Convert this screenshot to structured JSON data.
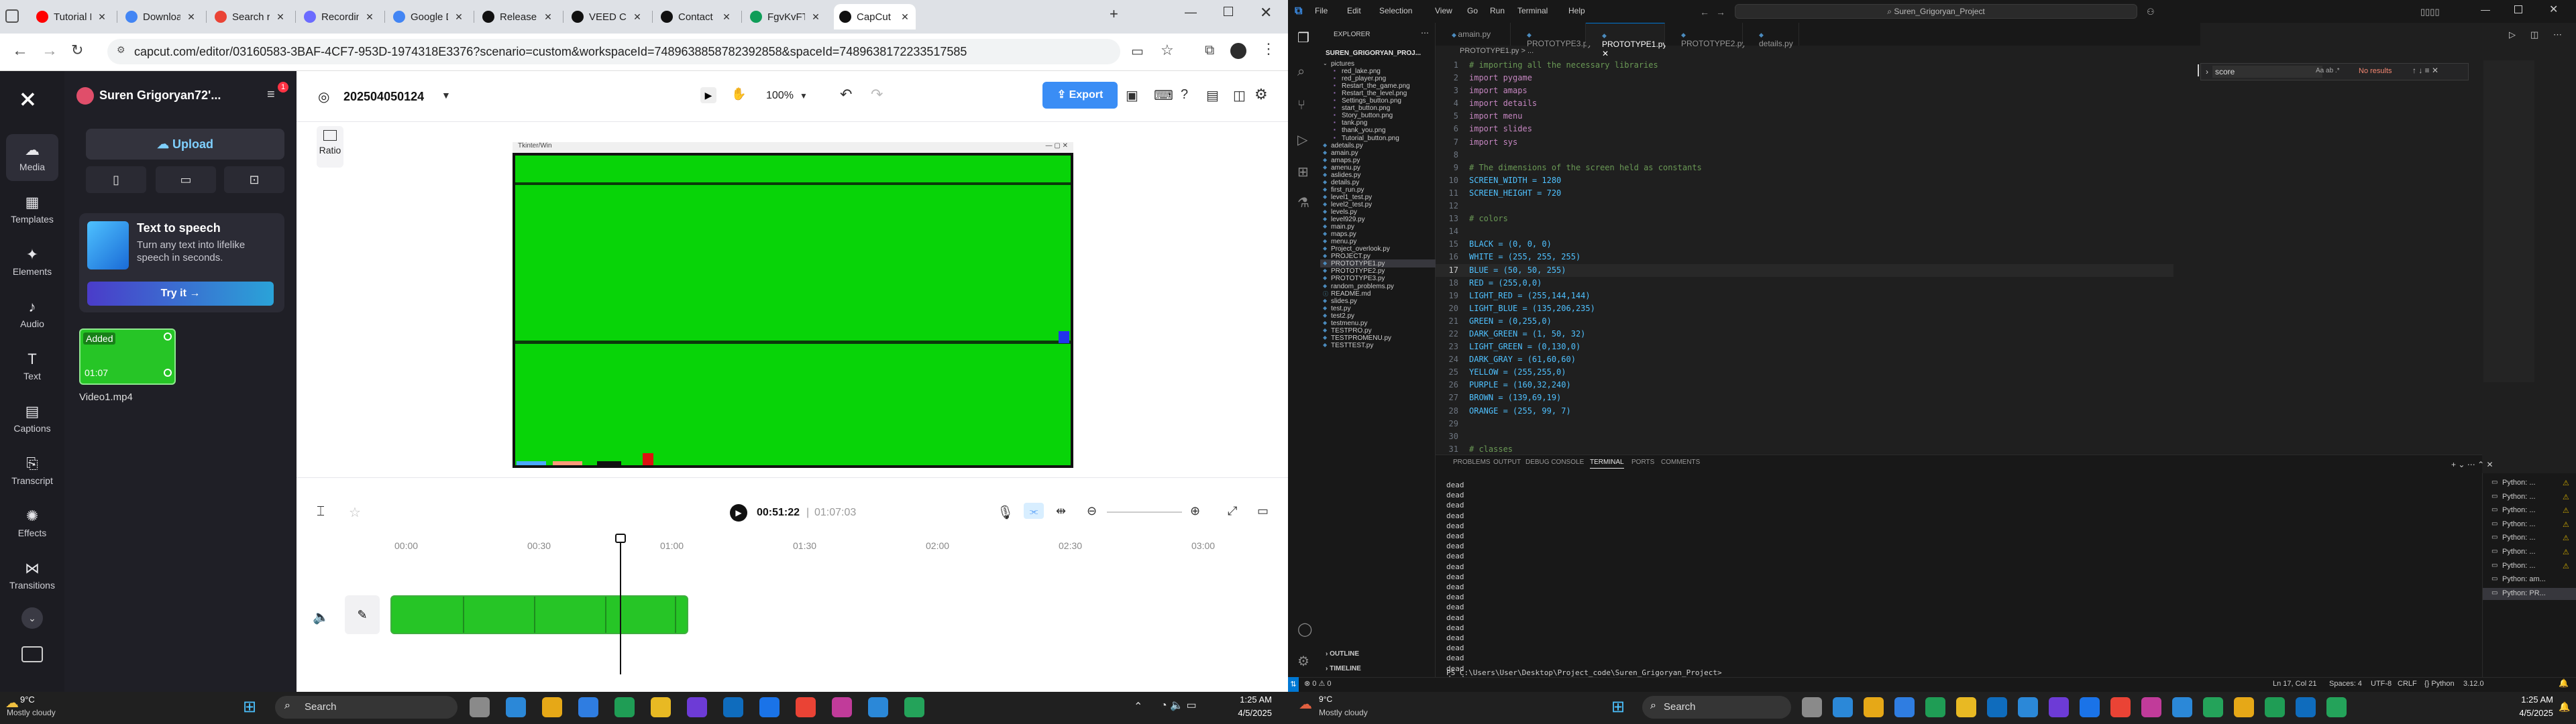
{
  "left_browser": {
    "tabs": [
      {
        "label": "Tutorial Pr",
        "color": "#ff0000"
      },
      {
        "label": "Download",
        "color": "#4285f4"
      },
      {
        "label": "Search res",
        "color": "#ea4335"
      },
      {
        "label": "Recording",
        "color": "#6b6bff"
      },
      {
        "label": "Google Do",
        "color": "#4285f4"
      },
      {
        "label": "Release S",
        "color": "#111111"
      },
      {
        "label": "VEED CRE",
        "color": "#111111"
      },
      {
        "label": "Contact S",
        "color": "#111111"
      },
      {
        "label": "FgvKvFTL",
        "color": "#0f9d58"
      },
      {
        "label": "CapCut | V",
        "color": "#111111"
      }
    ],
    "url": "capcut.com/editor/03160583-3BAF-4CF7-953D-1974318E3376?scenario=custom&workspaceId=7489638858782392858&spaceId=7489638172233517585"
  },
  "capcut": {
    "user": "Suren Grigoryan72'...",
    "project_title": "202504050124",
    "zoom": "100%",
    "export_label": "Export",
    "upload_label": "Upload",
    "notif_count": "1",
    "nav": [
      {
        "label": "Media",
        "icon": "cloud-icon"
      },
      {
        "label": "Templates",
        "icon": "templates-icon"
      },
      {
        "label": "Elements",
        "icon": "elements-icon"
      },
      {
        "label": "Audio",
        "icon": "audio-icon"
      },
      {
        "label": "Text",
        "icon": "text-icon"
      },
      {
        "label": "Captions",
        "icon": "captions-icon"
      },
      {
        "label": "Transcript",
        "icon": "transcript-icon"
      },
      {
        "label": "Effects",
        "icon": "effects-icon"
      },
      {
        "label": "Transitions",
        "icon": "transitions-icon"
      }
    ],
    "tts": {
      "title": "Text to speech",
      "desc": "Turn any text into lifelike speech in seconds.",
      "button": "Try it →"
    },
    "media_item": {
      "badge": "Added",
      "duration": "01:07",
      "name": "Video1.mp4"
    },
    "ratio_label": "Ratio",
    "game_window_title": "Tkinter/Win",
    "time_current": "00:51:22",
    "time_total": "01:07:03",
    "ruler": [
      "00:00",
      "00:30",
      "01:00",
      "01:30",
      "02:00",
      "02:30",
      "03:00"
    ]
  },
  "vscode": {
    "menu": [
      "File",
      "Edit",
      "Selection",
      "View",
      "Go",
      "Run",
      "Terminal",
      "Help"
    ],
    "search": "Suren_Grigoryan_Project",
    "tabs": [
      "amain.py",
      "PROTOTYPE3.py",
      "PROTOTYPE1.py",
      "PROTOTYPE2.py",
      "details.py"
    ],
    "active_tab": "PROTOTYPE1.py",
    "explorer_title": "EXPLORER",
    "root": "SUREN_GRIGORYAN_PROJ...",
    "files": [
      "pictures",
      "red_lake.png",
      "red_player.png",
      "Restart_the_game.png",
      "Restart_the_level.png",
      "Settings_button.png",
      "start_button.png",
      "Story_button.png",
      "tank.png",
      "thank_you.png",
      "Tutorial_button.png",
      "adetails.py",
      "amain.py",
      "amaps.py",
      "amenu.py",
      "aslides.py",
      "details.py",
      "first_run.py",
      "level1_test.py",
      "level2_test.py",
      "levels.py",
      "level929.py",
      "main.py",
      "maps.py",
      "menu.py",
      "Project_overlook.py",
      "PROJECT.py",
      "PROTOTYPE1.py",
      "PROTOTYPE2.py",
      "PROTOTYPE3.py",
      "random_problems.py",
      "README.md",
      "slides.py",
      "test.py",
      "test2.py",
      "testmenu.py",
      "TESTPRO.py",
      "TESTPROMENU.py",
      "TESTTEST.py"
    ],
    "outline": "OUTLINE",
    "timeline": "TIMELINE",
    "breadcrumb": "PROTOTYPE1.py > ...",
    "find_text": "score",
    "find_result": "No results",
    "code": [
      "# importing all the necessary libraries",
      "import pygame",
      "import amaps",
      "import details",
      "import menu",
      "import slides",
      "import sys",
      "",
      "# The dimensions of the screen held as constants",
      "SCREEN_WIDTH = 1280",
      "SCREEN_HEIGHT = 720",
      "",
      "# colors",
      "",
      "BLACK = (0, 0, 0)",
      "WHITE = (255, 255, 255)",
      "BLUE = (50, 50, 255)",
      "RED = (255,0,0)",
      "LIGHT_RED = (255,144,144)",
      "LIGHT_BLUE = (135,206,235)",
      "GREEN = (0,255,0)",
      "DARK_GREEN = (1, 50, 32)",
      "LIGHT_GREEN = (0,130,0)",
      "DARK_GRAY = (61,60,60)",
      "YELLOW = (255,255,0)",
      "PURPLE = (160,32,240)",
      "BROWN = (139,69,19)",
      "ORANGE = (255, 99, 7)",
      "",
      "",
      "# classes"
    ],
    "panel_tabs": [
      "PROBLEMS",
      "OUTPUT",
      "DEBUG CONSOLE",
      "TERMINAL",
      "PORTS",
      "COMMENTS"
    ],
    "active_panel_tab": "TERMINAL",
    "terminal_lines": [
      "dead",
      "dead",
      "dead",
      "dead",
      "dead",
      "dead",
      "dead",
      "dead",
      "dead",
      "dead",
      "dead",
      "dead",
      "dead",
      "dead",
      "dead",
      "dead",
      "dead",
      "dead",
      "dead",
      "dead",
      "dead"
    ],
    "prompt": "PS C:\\Users\\User\\Desktop\\Project_code\\Suren_Grigoryan_Project>",
    "terminals": [
      "Python: ...",
      "Python: ...",
      "Python: ...",
      "Python: ...",
      "Python: ...",
      "Python: ...",
      "Python: ...",
      "Python: am...",
      "Python: PR..."
    ],
    "status_left": "⊗ 0 ⚠ 0",
    "status_items": [
      "Ln 17, Col 21",
      "Spaces: 4",
      "UTF-8",
      "CRLF",
      "{} Python",
      "3.12.0"
    ]
  },
  "taskbar": {
    "left_weather_temp": "9°C",
    "left_weather_desc": "Mostly cloudy",
    "left_search": "Search",
    "left_time": "1:25 AM",
    "left_date": "4/5/2025",
    "right_weather_temp": "9°C",
    "right_weather_desc": "Mostly cloudy",
    "right_search": "Search",
    "right_time": "1:25 AM",
    "right_date": "4/5/2025"
  }
}
